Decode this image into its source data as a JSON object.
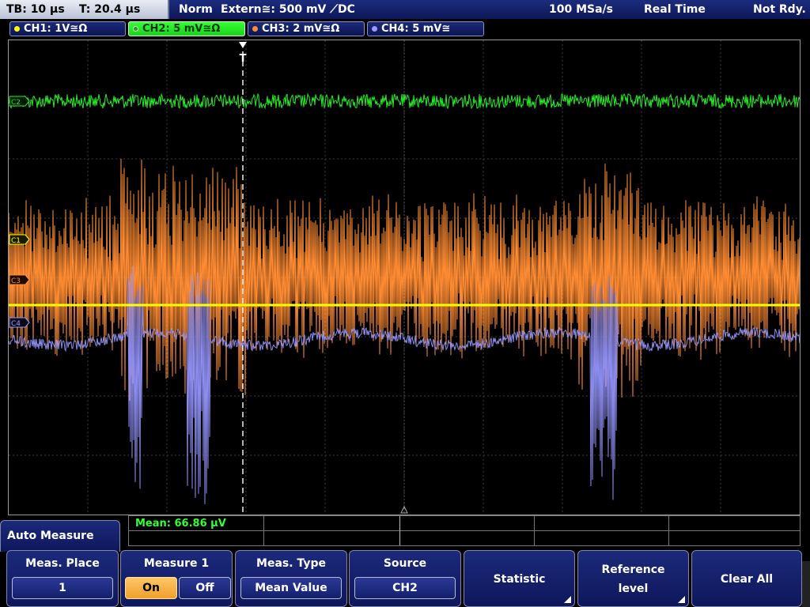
{
  "status_bar": {
    "timebase": "TB: 10 µs",
    "trigger_time": "T: 20.4 µs",
    "mode": "Norm",
    "trigger_source": "Extern≅: 500 mV ⟋DC",
    "sample_rate": "100 MSa/s",
    "acquisition": "Real Time",
    "state": "Not Rdy."
  },
  "channels": [
    {
      "id": "CH1",
      "label": "CH1: 1V≅Ω",
      "color": "#ffff00",
      "marker": "C1",
      "active": false
    },
    {
      "id": "CH2",
      "label": "CH2: 5 mV≅Ω",
      "color": "#33ff33",
      "marker": "C2",
      "active": true
    },
    {
      "id": "CH3",
      "label": "CH3: 2 mV≅Ω",
      "color": "#ff8c33",
      "marker": "C3",
      "active": false
    },
    {
      "id": "CH4",
      "label": "CH4: 5 mV≅",
      "color": "#9a9aff",
      "marker": "C4",
      "active": false
    }
  ],
  "trigger_marker": "T",
  "measurement": {
    "result": "Mean: 66.86 µV"
  },
  "menu": {
    "title": "Auto Measure",
    "softkeys": {
      "meas_place": {
        "label": "Meas. Place",
        "value": "1"
      },
      "measure1": {
        "label": "Measure 1",
        "on": "On",
        "off": "Off",
        "state": "On"
      },
      "meas_type": {
        "label": "Meas. Type",
        "value": "Mean Value"
      },
      "source": {
        "label": "Source",
        "value": "CH2"
      },
      "statistic": {
        "label": "Statistic"
      },
      "reference_level": {
        "line1": "Reference",
        "line2": "level"
      },
      "clear_all": {
        "label": "Clear All"
      }
    }
  }
}
